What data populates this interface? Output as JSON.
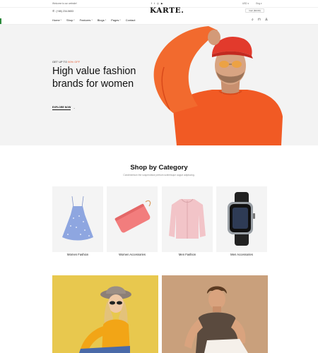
{
  "topbar": {
    "welcome": "Welcome to our website!",
    "socials": [
      "f-icon",
      "t-icon",
      "i-icon",
      "y-icon"
    ],
    "currency": "USD",
    "language": "Eng"
  },
  "header": {
    "phone": "(+88) 234-5653",
    "logo": "KARTE.",
    "cart_label": "Cart ($0.00)",
    "nav": [
      {
        "label": "Home",
        "dropdown": true
      },
      {
        "label": "Shop",
        "dropdown": true
      },
      {
        "label": "Features",
        "dropdown": true
      },
      {
        "label": "Blogs",
        "dropdown": true
      },
      {
        "label": "Pages",
        "dropdown": true
      },
      {
        "label": "Contact",
        "dropdown": false
      }
    ],
    "icons": [
      "search-icon",
      "bag-icon",
      "user-icon"
    ]
  },
  "hero": {
    "subtitle_prefix": "GET UP TO ",
    "subtitle_highlight": "50% OFF",
    "headline": "High value fashion brands for women",
    "cta": "EXPLORE NOW"
  },
  "categories": {
    "title": "Shop by Category",
    "subtitle": "Condimentum the suspendisse pretium scelerisque augue adipiscing.",
    "items": [
      {
        "label": "Women Fashion",
        "icon": "dress-image"
      },
      {
        "label": "Women Accessories",
        "icon": "wallet-image"
      },
      {
        "label": "Men Fashion",
        "icon": "jacket-image"
      },
      {
        "label": "Men Accessories",
        "icon": "watch-image"
      }
    ]
  },
  "colors": {
    "accent": "#e4572e",
    "hero_bg": "#f3f3f3",
    "banner_yellow": "#e8c84e",
    "banner_tan": "#c9a07c"
  }
}
